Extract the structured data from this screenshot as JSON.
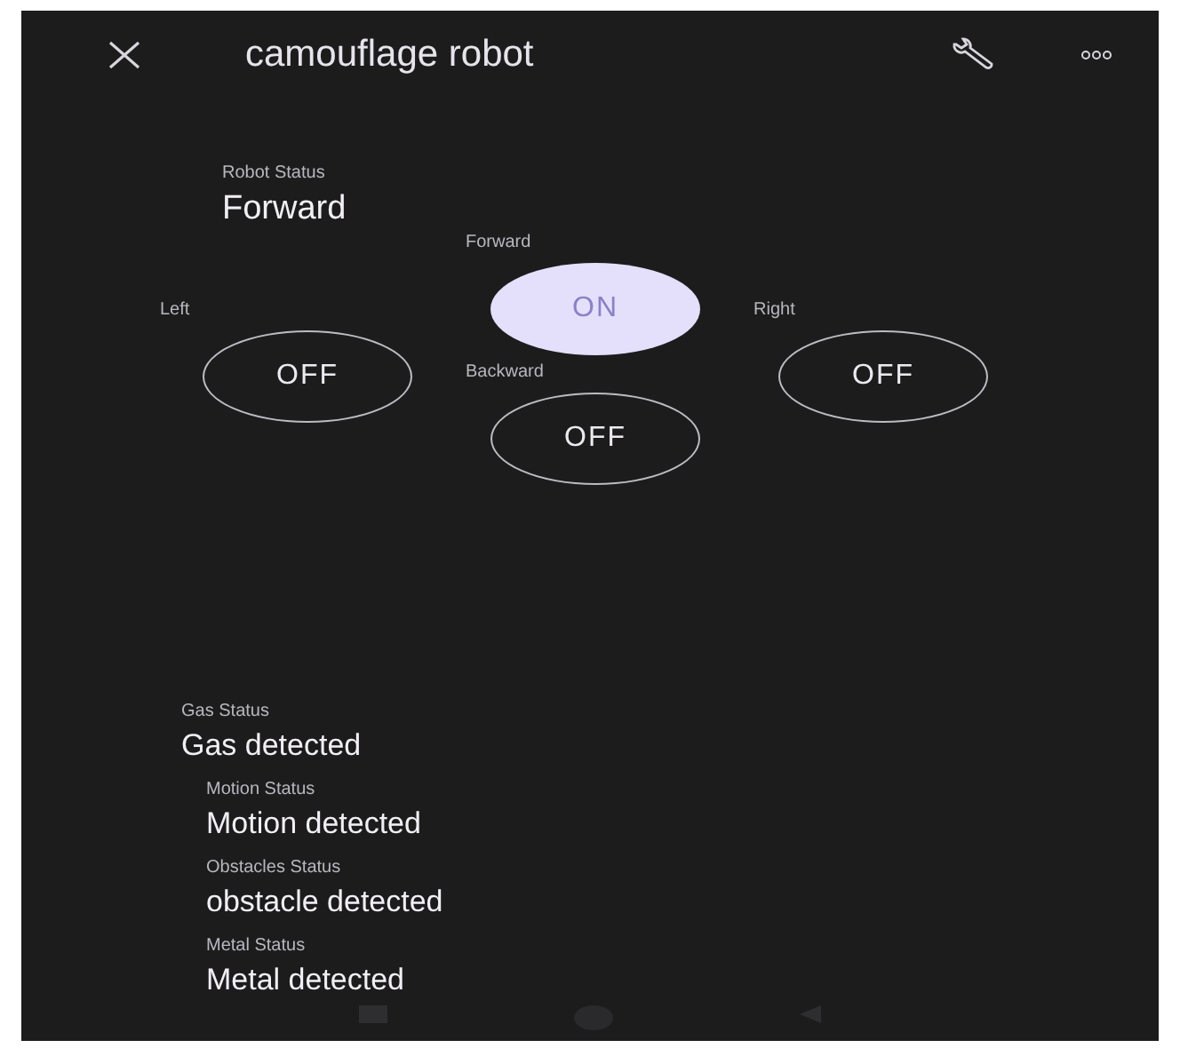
{
  "app_bar": {
    "title": "camouflage robot"
  },
  "robot_status": {
    "label": "Robot Status",
    "value": "Forward"
  },
  "controls": {
    "left": {
      "label": "Left",
      "text": "OFF",
      "on": false
    },
    "forward": {
      "label": "Forward",
      "text": "ON",
      "on": true
    },
    "backward": {
      "label": "Backward",
      "text": "OFF",
      "on": false
    },
    "right": {
      "label": "Right",
      "text": "OFF",
      "on": false
    }
  },
  "sensors": [
    {
      "label": "Gas Status",
      "value": "Gas detected"
    },
    {
      "label": "Motion Status",
      "value": "Motion detected"
    },
    {
      "label": "Obstacles Status",
      "value": "obstacle detected"
    },
    {
      "label": "Metal Status",
      "value": "Metal detected"
    }
  ]
}
